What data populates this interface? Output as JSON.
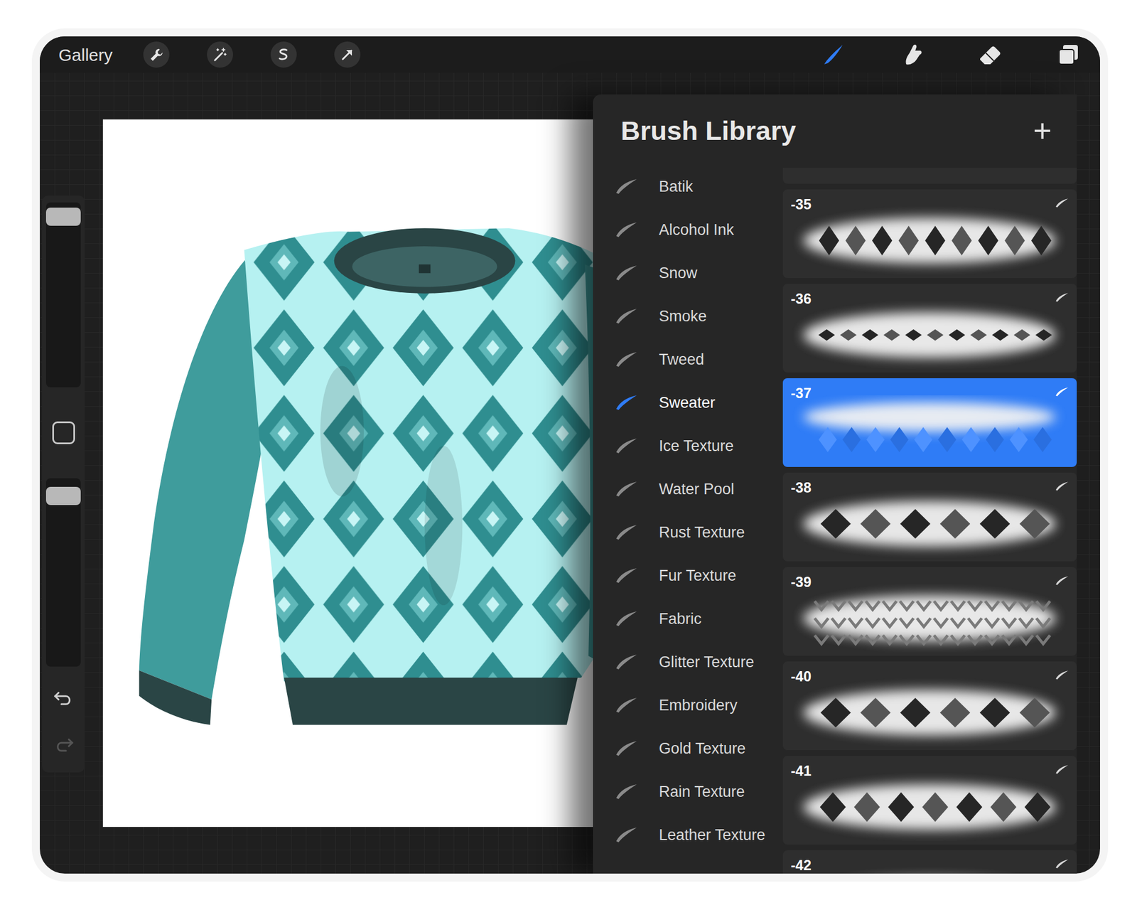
{
  "topbar": {
    "gallery": "Gallery",
    "actions": [
      {
        "kind": "wrench",
        "selected": false
      },
      {
        "kind": "magic",
        "selected": false
      },
      {
        "kind": "selection",
        "selected": false
      },
      {
        "kind": "transform",
        "selected": false
      }
    ],
    "tools": [
      {
        "kind": "brush",
        "selected": true
      },
      {
        "kind": "smudge",
        "selected": false
      },
      {
        "kind": "eraser",
        "selected": false
      },
      {
        "kind": "layers",
        "selected": false
      }
    ]
  },
  "sidebar": {
    "size_level": 0.97,
    "opacity_level": 0.95,
    "undo_disabled": false,
    "redo_disabled": true
  },
  "brush_library": {
    "title": "Brush Library",
    "add": "+",
    "categories": [
      {
        "label": "Batik",
        "selected": false
      },
      {
        "label": "Alcohol Ink",
        "selected": false
      },
      {
        "label": "Snow",
        "selected": false
      },
      {
        "label": "Smoke",
        "selected": false
      },
      {
        "label": "Tweed",
        "selected": false
      },
      {
        "label": "Sweater",
        "selected": true
      },
      {
        "label": "Ice Texture",
        "selected": false
      },
      {
        "label": "Water Pool",
        "selected": false
      },
      {
        "label": "Rust Texture",
        "selected": false
      },
      {
        "label": "Fur Texture",
        "selected": false
      },
      {
        "label": "Fabric",
        "selected": false
      },
      {
        "label": "Glitter Texture",
        "selected": false
      },
      {
        "label": "Embroidery",
        "selected": false
      },
      {
        "label": "Gold Texture",
        "selected": false
      },
      {
        "label": "Rain Texture",
        "selected": false
      },
      {
        "label": "Leather Texture",
        "selected": false
      }
    ],
    "brushes": [
      {
        "label": "-35",
        "selected": false
      },
      {
        "label": "-36",
        "selected": false
      },
      {
        "label": "-37",
        "selected": true
      },
      {
        "label": "-38",
        "selected": false
      },
      {
        "label": "-39",
        "selected": false
      },
      {
        "label": "-40",
        "selected": false
      },
      {
        "label": "-41",
        "selected": false
      },
      {
        "label": "-42",
        "selected": false
      }
    ]
  }
}
